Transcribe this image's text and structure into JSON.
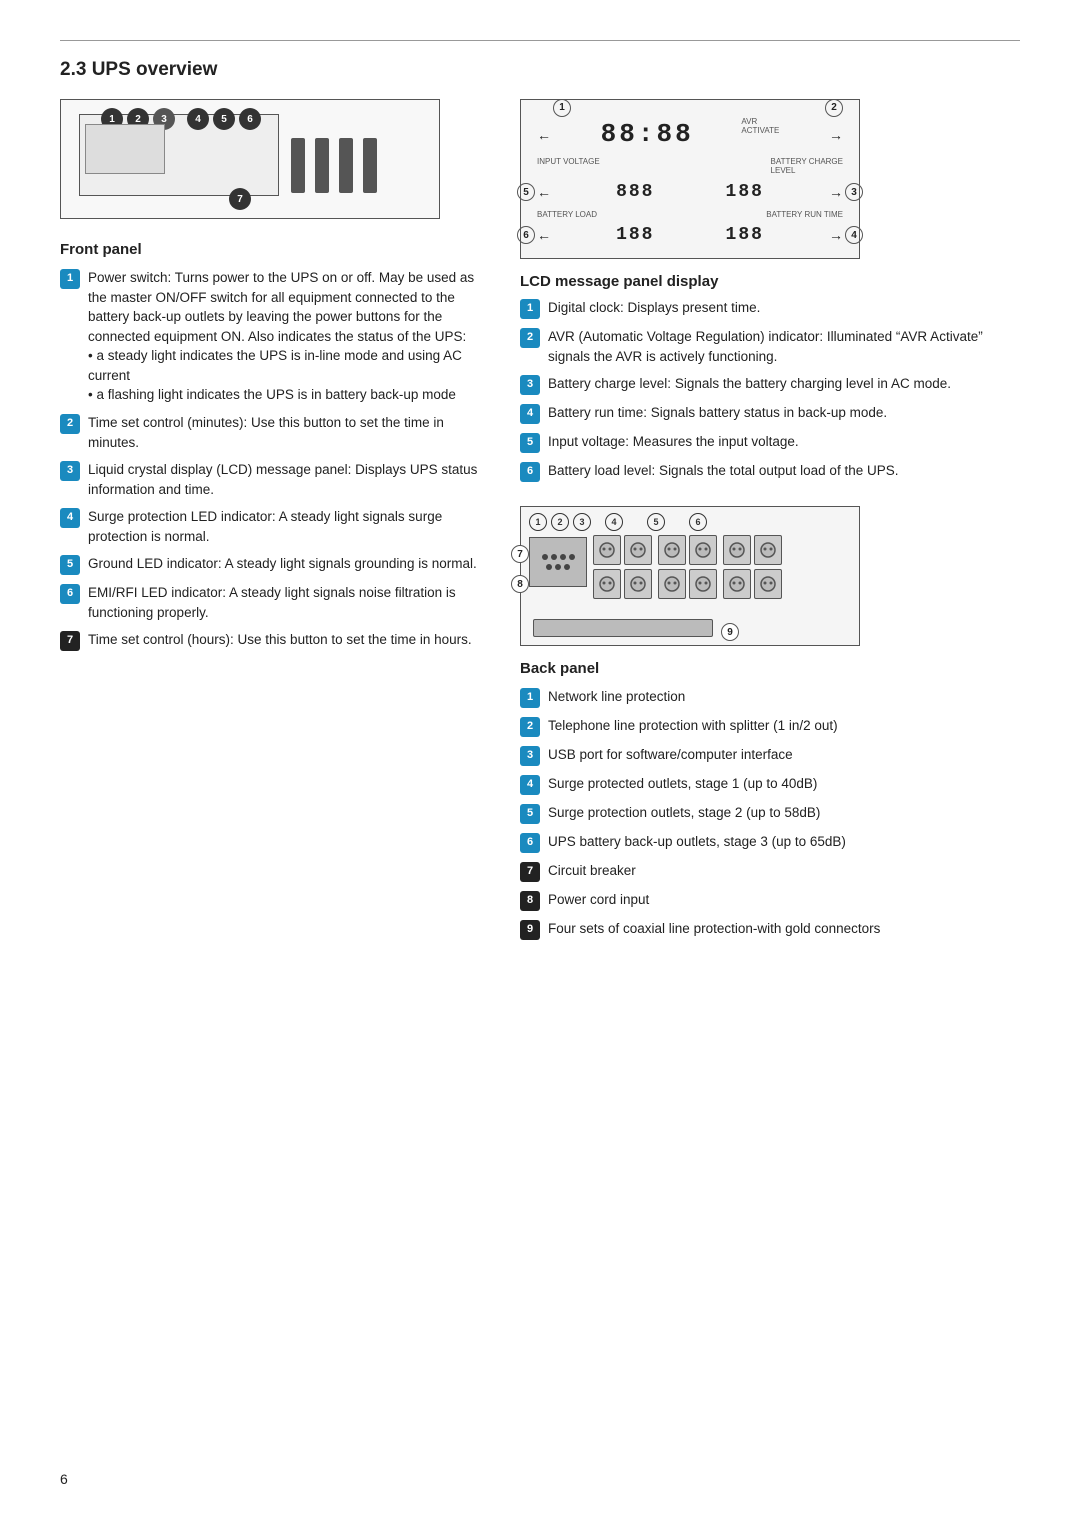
{
  "page": {
    "section": "2.3  UPS overview",
    "page_number": "6"
  },
  "front_panel": {
    "label": "Front panel",
    "items": [
      {
        "number": "1",
        "text": "Power switch: Turns power to the UPS on or off. May be used as the master ON/OFF switch for all equipment connected to the battery back-up outlets by leaving the power buttons for the connected equipment ON. Also indicates the status of the UPS:\n• a steady light indicates the UPS is in-line mode and using AC current\n• a flashing light indicates the UPS is in battery back-up mode"
      },
      {
        "number": "2",
        "text": "Time set control (minutes): Use this button to set the time in minutes."
      },
      {
        "number": "3",
        "text": "Liquid crystal display (LCD) message panel: Displays UPS status information and time."
      },
      {
        "number": "4",
        "text": "Surge protection LED indicator: A steady light signals surge protection is normal."
      },
      {
        "number": "5",
        "text": "Ground LED indicator: A steady light signals grounding is normal."
      },
      {
        "number": "6",
        "text": "EMI/RFI LED indicator: A steady light signals noise filtration is functioning properly."
      },
      {
        "number": "7",
        "text": "Time set control (hours): Use this button to set the time in hours."
      }
    ]
  },
  "lcd_panel": {
    "label": "LCD message panel display",
    "items": [
      {
        "number": "1",
        "text": "Digital clock: Displays present time."
      },
      {
        "number": "2",
        "text": "AVR (Automatic Voltage Regulation) indicator: Illuminated “AVR Activate” signals the AVR is actively functioning."
      },
      {
        "number": "3",
        "text": "Battery charge level: Signals the battery charging level in AC mode."
      },
      {
        "number": "4",
        "text": "Battery run time: Signals battery status in back-up mode."
      },
      {
        "number": "5",
        "text": "Input voltage: Measures the input voltage."
      },
      {
        "number": "6",
        "text": "Battery load level: Signals the total output load of the UPS."
      }
    ],
    "diagram": {
      "clock": "88: 88",
      "avr_label": "AVR\nACTIVATE",
      "input_voltage_label": "INPUT VOLTAGE",
      "battery_charge_label": "BATTERY CHARGE\nLEVEL",
      "battery_load_label": "BATTERY LOAD",
      "battery_run_label": "BATTERY RUN TIME",
      "seg1": "888",
      "seg2": "188",
      "seg3": "188",
      "seg4": "188"
    }
  },
  "back_panel": {
    "label": "Back panel",
    "items": [
      {
        "number": "1",
        "text": "Network line protection"
      },
      {
        "number": "2",
        "text": "Telephone line protection with splitter (1 in/2 out)"
      },
      {
        "number": "3",
        "text": "USB port for software/computer interface"
      },
      {
        "number": "4",
        "text": "Surge protected outlets, stage 1 (up to 40dB)"
      },
      {
        "number": "5",
        "text": "Surge protection outlets, stage 2 (up to 58dB)"
      },
      {
        "number": "6",
        "text": "UPS battery back-up outlets, stage 3 (up to 65dB)"
      },
      {
        "number": "7",
        "text": "Circuit breaker"
      },
      {
        "number": "8",
        "text": "Power cord input"
      },
      {
        "number": "9",
        "text": "Four sets of coaxial line protection-with gold connectors"
      }
    ]
  }
}
